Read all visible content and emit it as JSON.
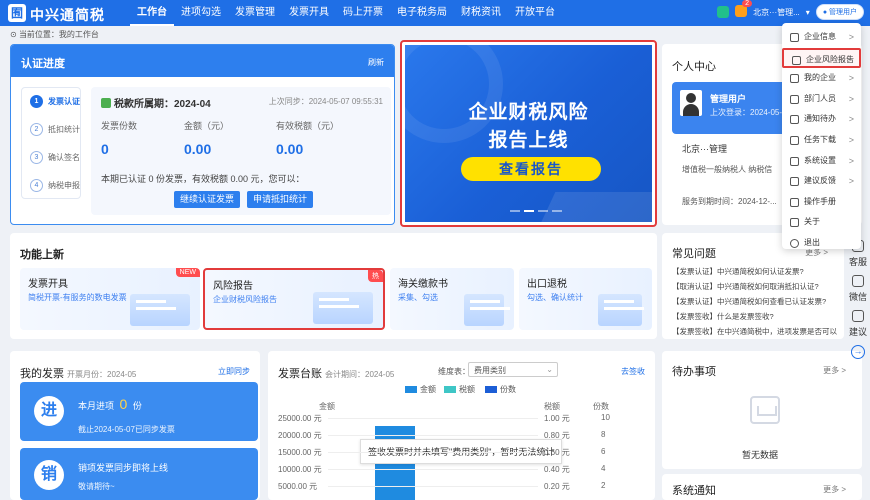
{
  "header": {
    "logo_glyph": "囿",
    "brand": "中兴通简税",
    "nav": [
      "工作台",
      "进项勾选",
      "发票管理",
      "发票开具",
      "码上开票",
      "电子税务局",
      "财税资讯",
      "开放平台"
    ],
    "active_nav": "工作台",
    "notify_badge": "2",
    "company": "北京···管理...",
    "user": "管理用户"
  },
  "breadcrumb": "当前位置：我的工作台",
  "auth": {
    "title": "认证进度",
    "refresh": "刷新",
    "steps": [
      "发票认证",
      "抵扣统计",
      "确认签名",
      "纳税申报"
    ],
    "period_label": "税款所属期：2024-04",
    "last_sync": "上次同步：2024-05-07 09:55:31",
    "stats": [
      {
        "label": "发票份数",
        "value": "0"
      },
      {
        "label": "金额（元）",
        "value": "0.00"
      },
      {
        "label": "有效税额（元）",
        "value": "0.00"
      }
    ],
    "summary": "本期已认证 0 份发票，有效税额 0.00 元，您可以：",
    "btn_continue": "继续认证发票",
    "btn_apply": "申请抵扣统计"
  },
  "banner": {
    "line1": "企业财税风险",
    "line2": "报告上线",
    "cta": "查看报告"
  },
  "personal": {
    "title": "个人中心",
    "user": "管理用户",
    "last_login": "上次登录：2024-05-07",
    "company": "北京···管理",
    "taxpayer": "增值税一般纳税人   纳税信",
    "service_time": "服务到期时间：2024-12-..."
  },
  "menu": {
    "items": [
      {
        "label": "企业信息",
        "arrow": ">"
      },
      {
        "label": "企业风险报告",
        "arrow": ">"
      },
      {
        "label": "我的企业",
        "arrow": ">"
      },
      {
        "label": "部门人员",
        "arrow": ">"
      },
      {
        "label": "通知待办",
        "arrow": ">"
      },
      {
        "label": "任务下载",
        "arrow": ">"
      },
      {
        "label": "系统设置",
        "arrow": ">"
      },
      {
        "label": "建议反馈",
        "arrow": ">"
      },
      {
        "label": "操作手册",
        "arrow": ""
      },
      {
        "label": "关于",
        "arrow": ""
      },
      {
        "label": "退出",
        "arrow": ""
      }
    ]
  },
  "side_tools": [
    "客服",
    "微信",
    "建议"
  ],
  "func": {
    "title": "功能上新",
    "tiles": [
      {
        "title": "发票开具",
        "desc": "简税开票-有服务的数电发票",
        "tag": "NEW"
      },
      {
        "title": "风险报告",
        "desc": "企业财税风险报告",
        "tag": "热"
      },
      {
        "title": "海关缴款书",
        "desc": "采集、勾选",
        "tag": ""
      },
      {
        "title": "出口退税",
        "desc": "勾选、确认统计",
        "tag": ""
      }
    ]
  },
  "faq": {
    "title": "常见问题",
    "more": "更多 >",
    "items": [
      "【发票认证】中兴通简税如何认证发票?",
      "【取消认证】中兴通简税如何取消抵扣认证?",
      "【发票认证】中兴通简税如何查看已认证发票?",
      "【发票签收】什么是发票签收?",
      "【发票签收】在中兴通简税中，进项发票是否可以"
    ]
  },
  "my_invoice": {
    "title": "我的发票",
    "month": "开票月份：2024-05",
    "sync": "立即同步",
    "in_icon": "进",
    "in_label": "本月进项",
    "in_count": "0",
    "in_unit": "份",
    "in_note": "截止2024-05-07已同步发票",
    "out_icon": "销",
    "out_label": "销项发票同步即将上线",
    "out_note": "敬请期待~"
  },
  "ledger": {
    "title": "发票台账",
    "period": "会计期间：2024-05",
    "dim_label": "维度表：",
    "dim_value": "费用类别",
    "link": "去签收",
    "tooltip": "签收发票时并未填写\"费用类别\"，暂时无法统计"
  },
  "todo": {
    "title": "待办事项",
    "more": "更多 >",
    "empty": "暂无数据"
  },
  "notice": {
    "title": "系统通知",
    "more": "更多 >"
  },
  "chart_data": {
    "type": "bar",
    "series": [
      {
        "name": "金额",
        "color": "#1f8be0"
      },
      {
        "name": "税额",
        "color": "#3ec6c6"
      },
      {
        "name": "份数",
        "color": "#1c5ed6"
      }
    ],
    "ylabel_left": "金额",
    "ylabel_right1": "税额",
    "ylabel_right2": "份数",
    "y_left_ticks": [
      "25000.00 元",
      "20000.00 元",
      "15000.00 元",
      "10000.00 元",
      "5000.00 元"
    ],
    "y_right1_ticks": [
      "1.00 元",
      "0.80 元",
      "0.60 元",
      "0.40 元",
      "0.20 元"
    ],
    "y_right2_ticks": [
      "10",
      "8",
      "6",
      "4",
      "2"
    ]
  }
}
